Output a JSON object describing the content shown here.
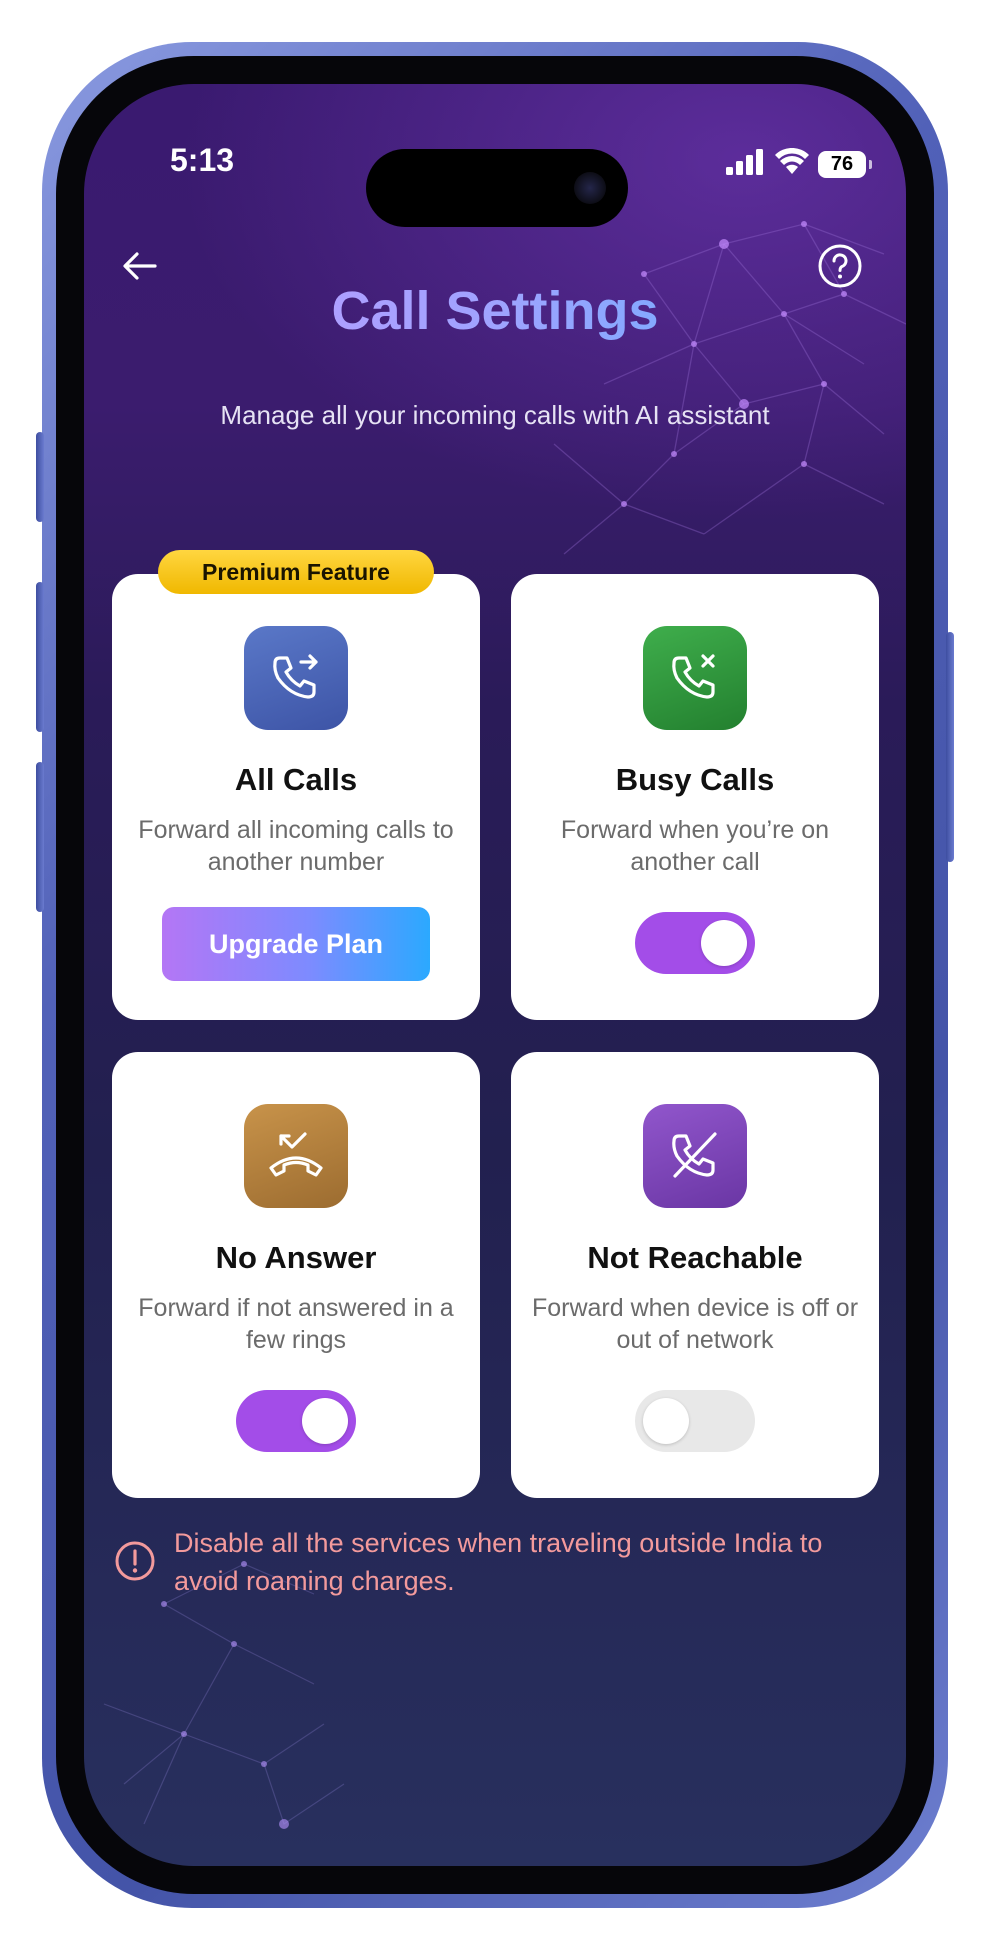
{
  "status_bar": {
    "time": "5:13",
    "battery": "76",
    "icons": [
      "signal-icon",
      "wifi-icon",
      "battery-icon"
    ]
  },
  "header": {
    "back_icon": "back-arrow-icon",
    "help_icon": "help-icon",
    "title": "Call Settings",
    "subtitle": "Manage all your incoming calls with AI assistant"
  },
  "cards": [
    {
      "title": "All Calls",
      "description": "Forward all incoming calls to another number",
      "badge": "Premium Feature",
      "action_label": "Upgrade Plan",
      "icon": "phone-forward-icon",
      "icon_color": "#4a64b6"
    },
    {
      "title": "Busy Calls",
      "description": "Forward when you’re on another call",
      "toggle": "on",
      "icon": "phone-x-icon",
      "icon_color": "#2e9a3e"
    },
    {
      "title": "No Answer",
      "description": "Forward if not answered in a few rings",
      "toggle": "on",
      "icon": "missed-call-icon",
      "icon_color": "#b6823e"
    },
    {
      "title": "Not Reachable",
      "description": "Forward when device is off or out of network",
      "toggle": "off",
      "icon": "phone-off-icon",
      "icon_color": "#7d45b4"
    }
  ],
  "warning": {
    "icon": "alert-circle-icon",
    "text": "Disable all the services when traveling outside India to avoid roaming charges."
  },
  "colors": {
    "toggle_on": "#a34de8",
    "toggle_off": "#e8e8e8",
    "warning_text": "#f39a9c",
    "badge": "#f5c518"
  }
}
